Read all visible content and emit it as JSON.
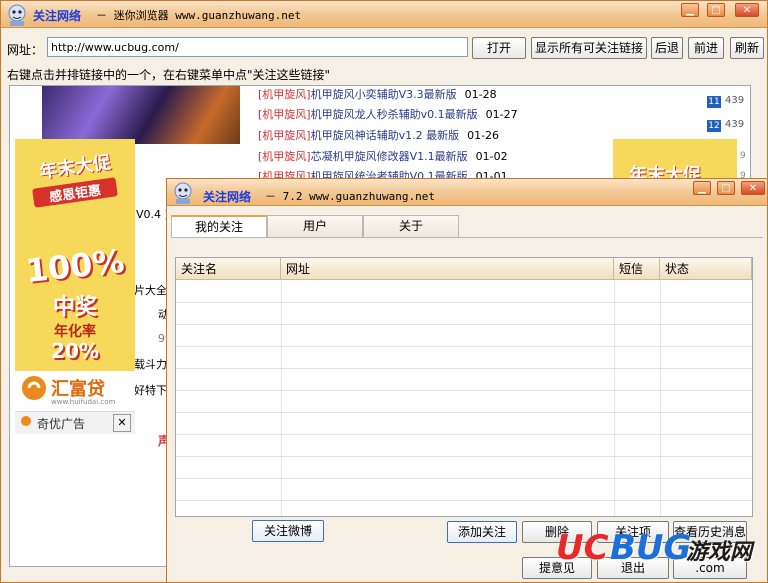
{
  "main": {
    "title_name": "关注网络",
    "title_sub": "－ 迷你浏览器 www.guanzhuwang.net",
    "address_label": "网址：",
    "address_value": "http://www.ucbug.com/",
    "buttons": {
      "open": "打开",
      "show_all": "显示所有可关注链接",
      "back": "后退",
      "forward": "前进",
      "refresh": "刷新"
    },
    "hint": "右键点击并排链接中的一个，在右键菜单中点\"关注这些链接\""
  },
  "webpage": {
    "links": [
      {
        "tag": "[机甲旋风]",
        "title": "机甲旋风小奕辅助V3.3最新版",
        "date": "01-28"
      },
      {
        "tag": "[机甲旋风]",
        "title": "机甲旋风龙人秒杀辅助v0.1最新版",
        "date": "01-27"
      },
      {
        "tag": "[机甲旋风]",
        "title": "机甲旋风神话辅助v1.2 最新版",
        "date": "01-26"
      },
      {
        "tag": "[机甲旋风]",
        "title": "芯凝机甲旋风修改器V1.1最新版",
        "date": "01-02"
      },
      {
        "tag": "[机甲旋风]",
        "title": "机甲旋风统治者辅助V0.1最新版",
        "date": "01-01"
      }
    ],
    "side_numbers": [
      {
        "n": "11",
        "v": "439"
      },
      {
        "n": "12",
        "v": "439"
      }
    ],
    "partial_texts": [
      "V0.4 ]",
      "片大全",
      "动",
      "99",
      "载斗力",
      "好特下",
      "声"
    ],
    "ad_left": {
      "line1": "年末大促",
      "line2": "感恩钜惠",
      "big": "100%",
      "mid": "中奖",
      "rate": "年化率",
      "pct": "20%",
      "brand": "汇富贷",
      "brand_url": "www.huifudai.com",
      "footer": "奇优广告",
      "close": "✕"
    },
    "ad_right": {
      "line1": "年末大促"
    }
  },
  "dialog": {
    "title_name": "关注网络",
    "title_sub": "－ 7.2 www.guanzhuwang.net",
    "tabs": [
      "我的关注",
      "用户",
      "关于"
    ],
    "columns": [
      "关注名",
      "网址",
      "短信",
      "状态"
    ],
    "buttons": {
      "weibo": "关注微博",
      "add": "添加关注",
      "delete": "删除",
      "items": "关注项",
      "history": "查看历史消息",
      "feedback": "提意见",
      "exit": "退出",
      "com": ".com"
    }
  },
  "watermark": {
    "uc": "UC",
    "bug": "BUG",
    "cn": "游戏网"
  },
  "colors": {
    "title_accent": "#1a3ce0",
    "border": "#c8782e",
    "link_tag": "#d23030"
  }
}
